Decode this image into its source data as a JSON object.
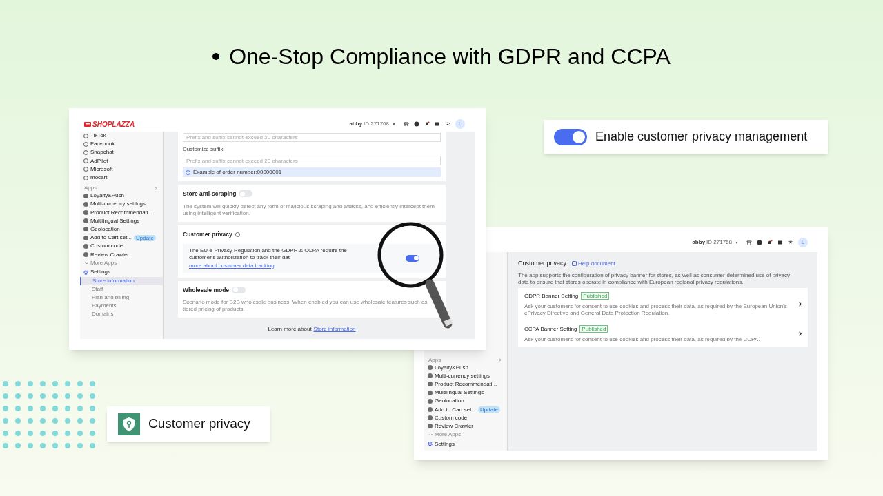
{
  "headline": "One-Stop Compliance with GDPR and CCPA",
  "callout_toggle": {
    "label": "Enable customer privacy management",
    "on": true
  },
  "app_badge": {
    "label": "Customer privacy"
  },
  "settings_window": {
    "logo": "SHOPLAZZA",
    "account": {
      "name": "abby",
      "id": "ID 271768"
    },
    "avatar_initial": "L",
    "sidebar": {
      "channels": [
        "TikTok",
        "Facebook",
        "Snapchat",
        "AdPilot",
        "Microsoft",
        "mocart"
      ],
      "apps_heading": "Apps",
      "apps": [
        {
          "label": "Loyalty&Push"
        },
        {
          "label": "Multi-currency settings"
        },
        {
          "label": "Product Recommendati..."
        },
        {
          "label": "Multilingual Settings"
        },
        {
          "label": "Geolocation"
        },
        {
          "label": "Add to Cart set...",
          "badge": "Update"
        },
        {
          "label": "Custom code"
        },
        {
          "label": "Review Crawler"
        }
      ],
      "more": "More Apps",
      "settings": "Settings",
      "settings_items": [
        {
          "label": "Store information",
          "selected": true
        },
        {
          "label": "Staff",
          "selected": false
        },
        {
          "label": "Plan and billing",
          "selected": false
        },
        {
          "label": "Payments",
          "selected": false
        },
        {
          "label": "Domains",
          "selected": false
        }
      ]
    },
    "order_number": {
      "prefix_placeholder": "Prefix and suffix cannot exceed 20 characters",
      "suffix_label": "Customize suffix",
      "suffix_placeholder": "Prefix and suffix cannot exceed 20 characters",
      "example": "Example of order number:00000001"
    },
    "cards": [
      {
        "kind": "toggle",
        "title": "Store anti-scraping",
        "on": false,
        "description": "The system will quickly detect any form of malicious scraping and attacks, and efficiently intercept them using intelligent verification."
      },
      {
        "kind": "privacy",
        "title": "Customer privacy",
        "on": true,
        "text": "The EU e-Privacy Regulation and the GDPR & CCPA require the customer's authorization to track their dat",
        "link": "more about customer data tracking"
      },
      {
        "kind": "toggle",
        "title": "Wholesale mode",
        "on": false,
        "description": "Scenario mode for B2B wholesale business. When enabled you can use wholesale features such as tiered pricing of products."
      }
    ],
    "footer": {
      "text": "Learn more about",
      "link": "Store information"
    }
  },
  "privacy_window": {
    "account": {
      "name": "abby",
      "id": "ID 271768"
    },
    "avatar_initial": "L",
    "title": "Customer privacy",
    "help": "Help document",
    "description": "The app supports the configuration of privacy banner for stores, as well as consumer-determined use of privacy data to ensure that stores operate in compliance with European regional privacy regulations.",
    "banners": [
      {
        "title": "GDPR Banner Setting",
        "status": "Published",
        "description": "Ask your customers for consent to use cookies and process their data, as required by the European Union's ePrivacy Directive and General Data Protection Regulation."
      },
      {
        "title": "CCPA Banner Setting",
        "status": "Published",
        "description": "Ask your customers for consent to use cookies and process their data, as required by the CCPA."
      }
    ],
    "sidebar": {
      "apps_heading": "Apps",
      "apps": [
        {
          "label": "Loyalty&Push"
        },
        {
          "label": "Multi-currency settings"
        },
        {
          "label": "Product Recommendati..."
        },
        {
          "label": "Multilingual Settings"
        },
        {
          "label": "Geolocation"
        },
        {
          "label": "Add to Cart set...",
          "badge": "Update"
        },
        {
          "label": "Custom code"
        },
        {
          "label": "Review Crawler"
        }
      ],
      "more": "More Apps",
      "settings": "Settings"
    }
  }
}
